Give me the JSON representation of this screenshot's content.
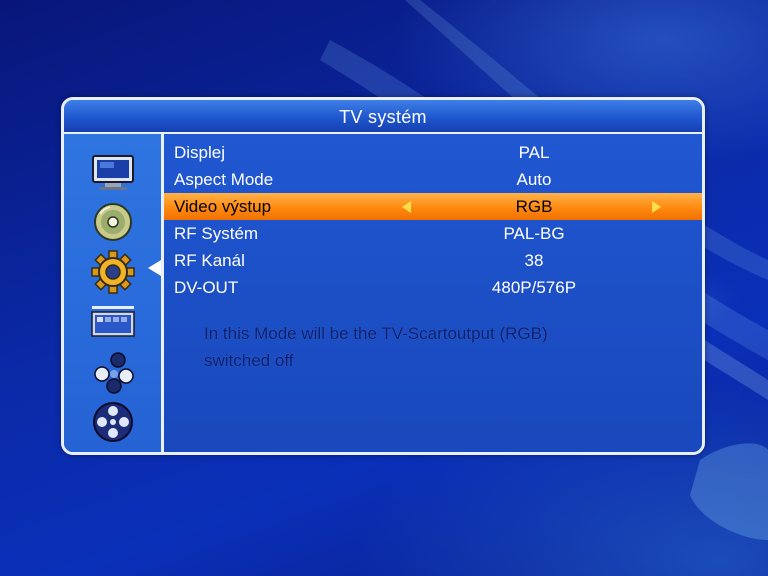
{
  "window": {
    "title": "TV systém"
  },
  "sidebar": {
    "items": [
      {
        "icon": "tv-monitor-icon"
      },
      {
        "icon": "disc-icon"
      },
      {
        "icon": "gear-icon",
        "selected": true
      },
      {
        "icon": "screen-panel-icon"
      },
      {
        "icon": "molecule-icon"
      },
      {
        "icon": "film-reel-icon"
      }
    ]
  },
  "settings": {
    "rows": [
      {
        "label": "Displej",
        "value": "PAL"
      },
      {
        "label": "Aspect Mode",
        "value": "Auto"
      },
      {
        "label": "Video výstup",
        "value": "RGB",
        "selected": true
      },
      {
        "label": "RF Systém",
        "value": "PAL-BG"
      },
      {
        "label": "RF Kanál",
        "value": "38"
      },
      {
        "label": "DV-OUT",
        "value": "480P/576P"
      }
    ]
  },
  "help": {
    "line1": "In this Mode will be the TV-Scartoutput (RGB)",
    "line2": "switched off"
  },
  "colors": {
    "selection": "#ff8a10",
    "selection_arrows": "#ffe04a",
    "panel": "#1d4fc9",
    "border": "#e8f0ff"
  }
}
